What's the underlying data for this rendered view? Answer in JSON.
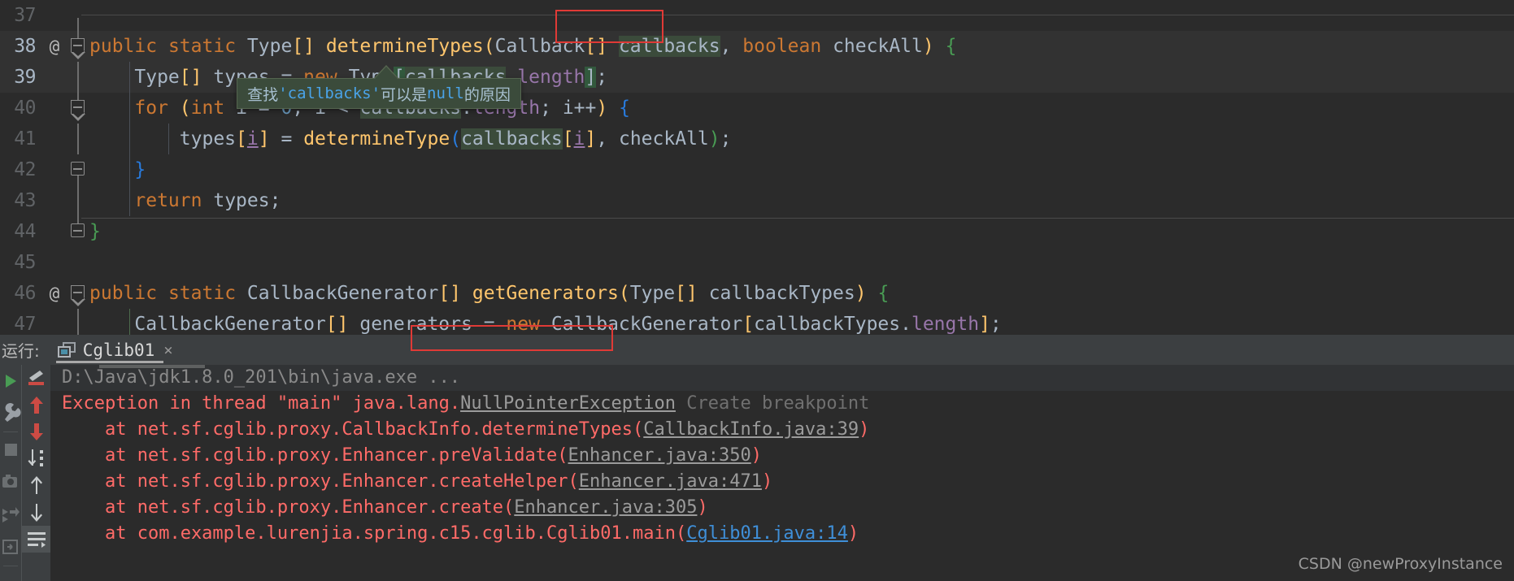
{
  "editor": {
    "lines": [
      {
        "num": "37",
        "at": "",
        "fold": "",
        "tokens": []
      },
      {
        "num": "38",
        "at": "@",
        "fold": "arrow",
        "text": "    public static Type[] determineTypes(Callback[] callbacks, boolean checkAll) {"
      },
      {
        "num": "39",
        "at": "",
        "fold": "",
        "text": "        Type[] types = new Type[callbacks.length];"
      },
      {
        "num": "40",
        "at": "",
        "fold": "arrow",
        "text": "        for (int i = 0; i < callbacks.length; i++) {"
      },
      {
        "num": "41",
        "at": "",
        "fold": "",
        "text": "            types[i] = determineType(callbacks[i], checkAll);"
      },
      {
        "num": "42",
        "at": "",
        "fold": "end",
        "text": "        }"
      },
      {
        "num": "43",
        "at": "",
        "fold": "",
        "text": "        return types;"
      },
      {
        "num": "44",
        "at": "",
        "fold": "end",
        "text": "    }"
      },
      {
        "num": "45",
        "at": "",
        "fold": "",
        "text": ""
      },
      {
        "num": "46",
        "at": "@",
        "fold": "arrow",
        "text": "    public static CallbackGenerator[] getGenerators(Type[] callbackTypes) {"
      },
      {
        "num": "47",
        "at": "",
        "fold": "",
        "text": "        CallbackGenerator[] generators = new CallbackGenerator[callbackTypes.length];"
      }
    ],
    "highlighted_symbol": "callbacks",
    "tooltip": {
      "prefix": "查找 ",
      "symbol": "'callbacks'",
      "middle": " 可以是 ",
      "keyword": "null",
      "suffix": " 的原因"
    }
  },
  "run_panel": {
    "label": "运行:",
    "tab": {
      "title": "Cglib01",
      "close": "×"
    },
    "toolbar": [
      {
        "name": "rerun-icon"
      },
      {
        "name": "wrench-icon"
      },
      {
        "name": "stop-icon"
      },
      {
        "name": "camera-icon"
      },
      {
        "name": "export-icon"
      },
      {
        "name": "print-icon"
      }
    ],
    "side_toolbar": [
      {
        "name": "filter-stacktrace-icon"
      },
      {
        "name": "up-red-arrow-icon"
      },
      {
        "name": "down-red-arrow-icon"
      },
      {
        "name": "sort-icon"
      },
      {
        "name": "scroll-up-icon"
      },
      {
        "name": "scroll-down-icon"
      },
      {
        "name": "soft-wrap-icon"
      }
    ],
    "console": [
      {
        "type": "cmd",
        "text": "D:\\Java\\jdk1.8.0_201\\bin\\java.exe ..."
      },
      {
        "type": "err_head",
        "pre": "Exception in thread \"main\" java.lang.",
        "link": "NullPointerException",
        "hint": "Create breakpoint"
      },
      {
        "type": "err",
        "pre": "    at net.sf.cglib.proxy.CallbackInfo.determineTypes(",
        "link": "CallbackInfo.java:39",
        "post": ")",
        "link_style": "grey"
      },
      {
        "type": "err",
        "pre": "    at net.sf.cglib.proxy.Enhancer.preValidate(",
        "link": "Enhancer.java:350",
        "post": ")",
        "link_style": "grey"
      },
      {
        "type": "err",
        "pre": "    at net.sf.cglib.proxy.Enhancer.createHelper(",
        "link": "Enhancer.java:471",
        "post": ")",
        "link_style": "grey"
      },
      {
        "type": "err",
        "pre": "    at net.sf.cglib.proxy.Enhancer.create(",
        "link": "Enhancer.java:305",
        "post": ")",
        "link_style": "grey"
      },
      {
        "type": "err",
        "pre": "    at com.example.lurenjia.spring.c15.cglib.Cglib01.main(",
        "link": "Cglib01.java:14",
        "post": ")",
        "link_style": "blue"
      }
    ]
  },
  "watermark": "CSDN @newProxyInstance",
  "colors": {
    "editor_bg": "#2b2b2b",
    "panel_bg": "#3c3f41",
    "highlight_box": "#e03a36",
    "error_text": "#ff6b68",
    "keyword": "#cc7832",
    "method": "#ffc66d",
    "link_blue": "#3f8fd8"
  }
}
